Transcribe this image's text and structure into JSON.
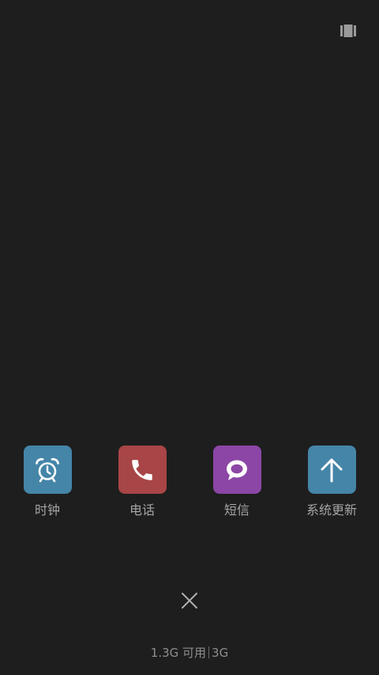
{
  "top_bar": {
    "layout_icon": "layout-toggle-icon"
  },
  "apps": [
    {
      "label": "时钟",
      "icon": "alarm-clock-icon",
      "color": "#4585a8"
    },
    {
      "label": "电话",
      "icon": "phone-icon",
      "color": "#a84546"
    },
    {
      "label": "短信",
      "icon": "chat-bubble-icon",
      "color": "#8c46a6"
    },
    {
      "label": "系统更新",
      "icon": "arrow-up-icon",
      "color": "#4585a8"
    }
  ],
  "close": {
    "icon": "close-icon"
  },
  "memory": {
    "available": "1.3G 可用",
    "total": "3G"
  }
}
